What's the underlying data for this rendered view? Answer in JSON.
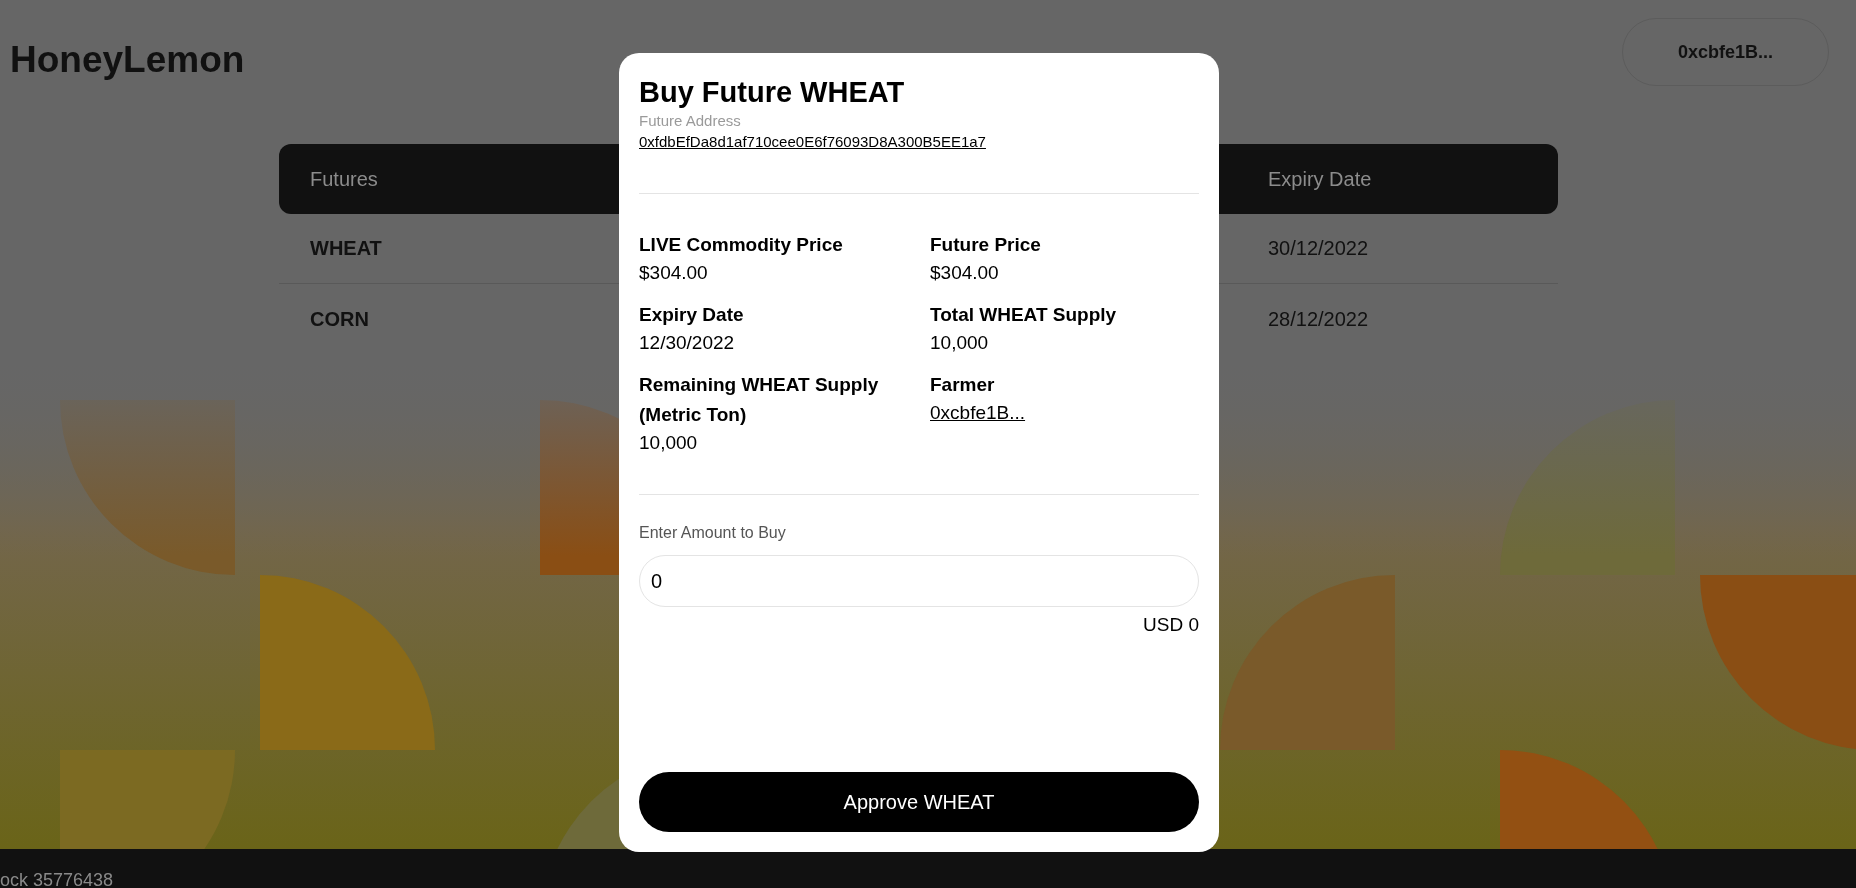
{
  "app": {
    "title": "HoneyLemon",
    "wallet_button": "0xcbfe1B..."
  },
  "table": {
    "columns": [
      "Futures",
      "Expiry Date"
    ],
    "rows": [
      {
        "future": "WHEAT",
        "expiry_date": "30/12/2022"
      },
      {
        "future": "CORN",
        "expiry_date": "28/12/2022"
      }
    ]
  },
  "modal": {
    "title": "Buy Future WHEAT",
    "address_label": "Future Address",
    "address": "0xfdbEfDa8d1af710cee0E6f76093D8A300B5EE1a7",
    "fields": [
      {
        "label": "LIVE Commodity Price",
        "value": "$304.00",
        "kind": "text"
      },
      {
        "label": "Future Price",
        "value": "$304.00",
        "kind": "text"
      },
      {
        "label": "Expiry Date",
        "value": "12/30/2022",
        "kind": "text"
      },
      {
        "label": "Total WHEAT Supply",
        "value": "10,000",
        "kind": "text"
      },
      {
        "label": "Remaining WHEAT Supply (Metric Ton)",
        "value": "10,000",
        "kind": "text"
      },
      {
        "label": "Farmer",
        "value": "0xcbfe1B...",
        "kind": "link"
      }
    ],
    "amount": {
      "label": "Enter Amount to Buy",
      "value": "0"
    },
    "converted": "USD 0",
    "button": "Approve WHEAT"
  },
  "footer": {
    "block": "ock 35776438"
  }
}
